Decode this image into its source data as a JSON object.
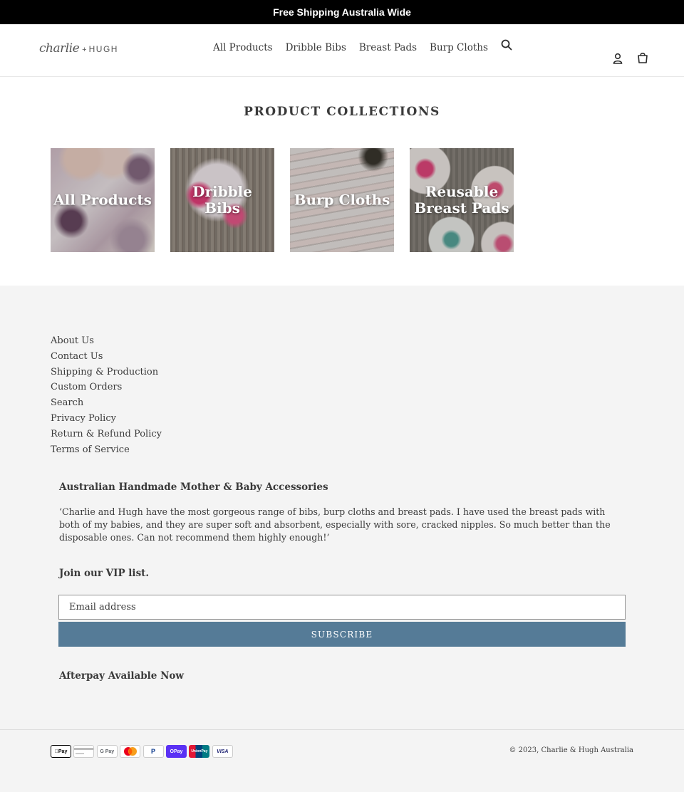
{
  "announcement": "Free Shipping Australia Wide",
  "logo": {
    "script": "charlie",
    "plus": "+",
    "name": "HUGH"
  },
  "nav": [
    "All Products",
    "Dribble Bibs",
    "Breast Pads",
    "Burp Cloths"
  ],
  "header_icons": [
    "search-icon",
    "account-icon",
    "cart-icon"
  ],
  "page_title": "PRODUCT COLLECTIONS",
  "collections": [
    {
      "label": "All Products"
    },
    {
      "label": "Dribble Bibs"
    },
    {
      "label": "Burp Cloths"
    },
    {
      "label": "Reusable Breast Pads"
    }
  ],
  "footer": {
    "links": [
      "About Us",
      "Contact Us",
      "Shipping & Production",
      "Custom Orders",
      "Search",
      "Privacy Policy",
      "Return & Refund Policy",
      "Terms of Service"
    ],
    "about_title": "Australian Handmade Mother & Baby Accessories",
    "quote": "‘Charlie and Hugh have the most gorgeous range of bibs, burp cloths and breast pads. I have used the breast pads with both of my babies, and they are super soft and absorbent, especially with sore, cracked nipples. So much better than the disposable ones. Can not recommend them highly enough!’",
    "vip_title": "Join our VIP list.",
    "email_placeholder": "Email address",
    "subscribe_label": "SUBSCRIBE",
    "afterpay": "Afterpay Available Now",
    "payment_icons": [
      {
        "name": "apple-pay-icon",
        "text": "Pay"
      },
      {
        "name": "generic-card-icon",
        "text": ""
      },
      {
        "name": "google-pay-icon",
        "text": "G Pay"
      },
      {
        "name": "mastercard-icon",
        "text": ""
      },
      {
        "name": "paypal-icon",
        "text": "P"
      },
      {
        "name": "shop-pay-icon",
        "text": "OPay"
      },
      {
        "name": "union-pay-icon",
        "text": "UnionPay"
      },
      {
        "name": "visa-icon",
        "text": "VISA"
      }
    ],
    "copyright_prefix": "© 2023, ",
    "copyright_link": "Charlie & Hugh Australia"
  },
  "colors": {
    "accent": "#557b97",
    "announcement_bg": "#000000",
    "footer_bg": "#f4f4f4"
  }
}
